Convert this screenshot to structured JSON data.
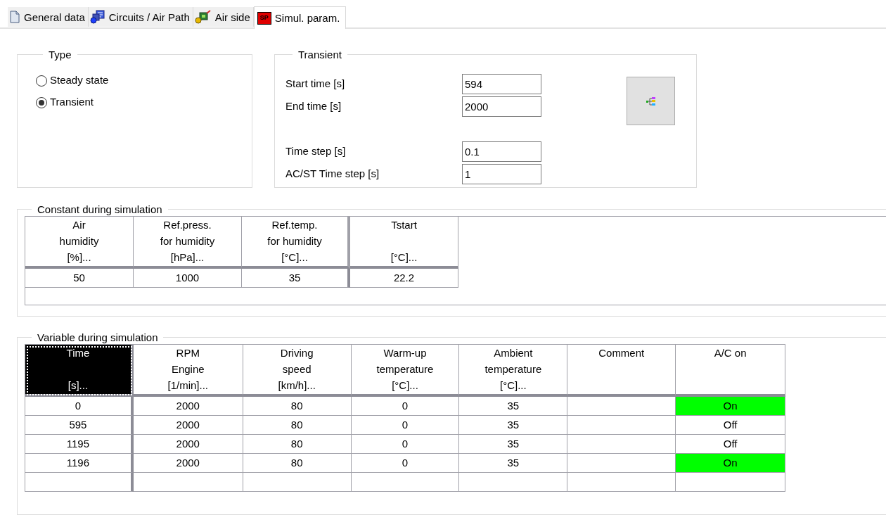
{
  "tabs": [
    {
      "label": "General data",
      "selected": false
    },
    {
      "label": "Circuits / Air Path",
      "selected": false
    },
    {
      "label": "Air side",
      "selected": false
    },
    {
      "label": "Simul. param.",
      "icon_text": "SP",
      "selected": true
    }
  ],
  "type_group": {
    "title": "Type",
    "options": [
      {
        "label": "Steady state",
        "selected": false
      },
      {
        "label": "Transient",
        "selected": true
      }
    ]
  },
  "transient_group": {
    "title": "Transient",
    "fields": [
      {
        "label": "Start time [s]",
        "value": "594",
        "gap_before": false
      },
      {
        "label": "End time [s]",
        "value": "2000",
        "gap_before": false
      },
      {
        "label": "Time step [s]",
        "value": "0.1",
        "gap_before": true
      },
      {
        "label": "AC/ST Time step [s]",
        "value": "1",
        "gap_before": false
      }
    ]
  },
  "constant_group": {
    "title": "Constant during simulation",
    "columns": [
      "Air\nhumidity\n[%]...",
      "Ref.press.\nfor humidity\n[hPa]...",
      "Ref.temp.\nfor humidity\n[°C]...",
      "Tstart\n\n[°C]..."
    ],
    "rows": [
      [
        "50",
        "1000",
        "35",
        "22.2"
      ]
    ]
  },
  "variable_group": {
    "title": "Variable during simulation",
    "columns": [
      {
        "label": "Time\n\n[s]...",
        "selected": true
      },
      {
        "label": "RPM\nEngine\n[1/min]...",
        "selected": false
      },
      {
        "label": "Driving\nspeed\n[km/h]...",
        "selected": false
      },
      {
        "label": "Warm-up\ntemperature\n[°C]...",
        "selected": false
      },
      {
        "label": "Ambient\ntemperature\n[°C]...",
        "selected": false
      },
      {
        "label": "Comment",
        "selected": false
      },
      {
        "label": "A/C on",
        "selected": false
      }
    ],
    "rows": [
      {
        "cells": [
          "0",
          "2000",
          "80",
          "0",
          "35"
        ],
        "ac": {
          "text": "On",
          "on": true
        }
      },
      {
        "cells": [
          "595",
          "2000",
          "80",
          "0",
          "35"
        ],
        "ac": {
          "text": "Off",
          "on": false
        }
      },
      {
        "cells": [
          "1195",
          "2000",
          "80",
          "0",
          "35"
        ],
        "ac": {
          "text": "Off",
          "on": false
        }
      },
      {
        "cells": [
          "1196",
          "2000",
          "80",
          "0",
          "35"
        ],
        "ac": {
          "text": "On",
          "on": true
        }
      }
    ]
  }
}
